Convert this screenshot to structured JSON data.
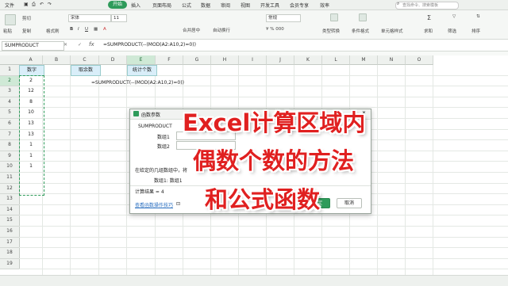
{
  "menubar": {
    "file": "文件",
    "items": [
      "开始",
      "插入",
      "页面布局",
      "公式",
      "数据",
      "审阅",
      "视图",
      "开发工具",
      "会员专享",
      "效率"
    ],
    "active_index": 0,
    "search": "查找命令、搜索模板",
    "accent": "#2e9b5a"
  },
  "ribbon": {
    "paste": "粘贴",
    "cut": "剪切",
    "copy": "复制",
    "format_painter": "格式刷",
    "font": "宋体",
    "font_size": "11",
    "merge_center": "合并居中",
    "wrap": "自动换行",
    "number_format": "常规",
    "type_convert": "类型转换",
    "cond_format": "条件格式",
    "cell_style": "单元格样式",
    "sum": "求和",
    "filter": "筛选",
    "sort": "排序"
  },
  "formula_bar": {
    "name_box": "SUMPRODUCT",
    "fx": "fx",
    "formula": "=SUMPRODUCT(--(MOD(A2:A10,2)=0))"
  },
  "grid": {
    "columns": [
      "A",
      "B",
      "C",
      "D",
      "E",
      "F",
      "G",
      "H",
      "I",
      "J",
      "K",
      "L",
      "M",
      "N",
      "O"
    ],
    "rows": [
      "1",
      "2",
      "3",
      "4",
      "5",
      "6",
      "7",
      "8",
      "9",
      "10",
      "11",
      "12",
      "13",
      "14",
      "15",
      "16",
      "17",
      "18",
      "19"
    ],
    "a1": "数字",
    "c1": "取余数",
    "e1": "统计个数",
    "a_values": [
      "2",
      "12",
      "8",
      "10",
      "13",
      "13",
      "1",
      "1",
      "1"
    ],
    "c2_formula": "=SUMPRODUCT(--(MOD(A2:A10,2)=0))"
  },
  "dialog": {
    "title": "函数参数",
    "func": "SUMPRODUCT",
    "arg1_label": "数组1",
    "arg2_label": "数组2",
    "desc": "在给定的几组数组中，将",
    "arg_desc": "数组1: 数组1",
    "result": "计算结果 = 4",
    "help_link": "查看函数操作技巧",
    "ok": "确定",
    "cancel": "取消"
  },
  "overlay": {
    "line1": "Excel计算区域内",
    "line2": "偶数个数的方法",
    "line3": "和公式函数",
    "color": "#e02020"
  }
}
